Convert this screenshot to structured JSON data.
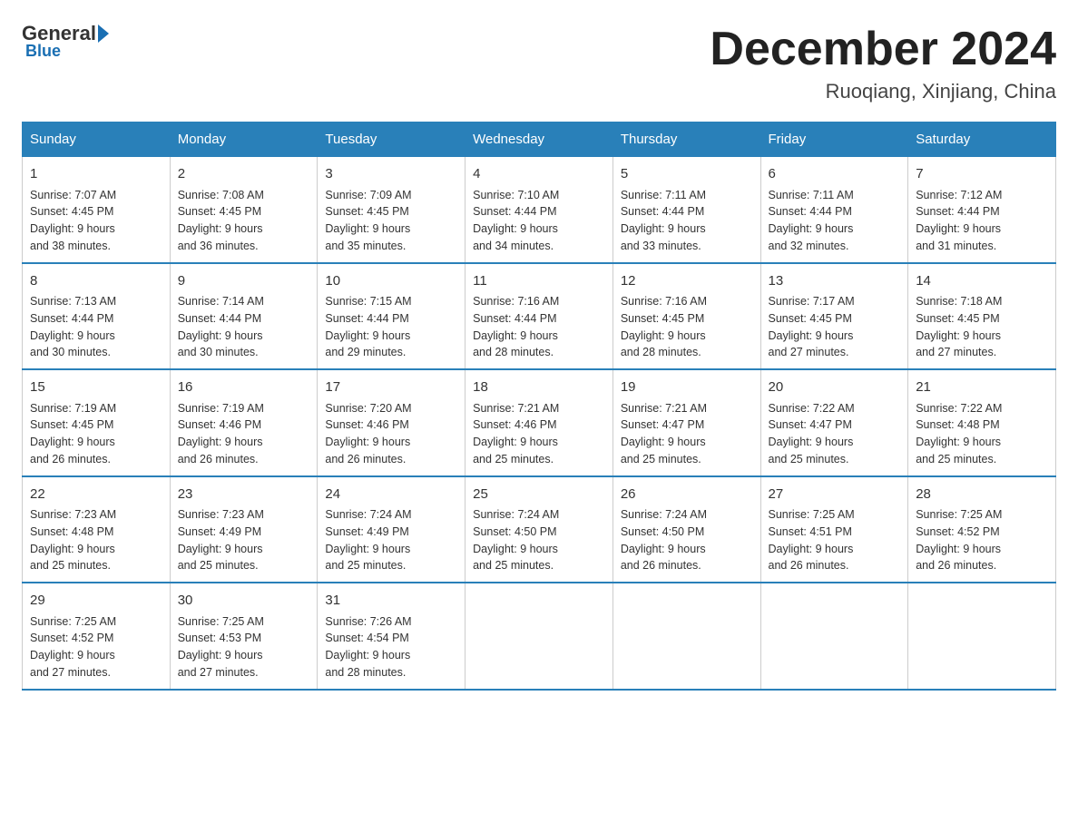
{
  "logo": {
    "general": "General",
    "blue": "Blue"
  },
  "title": "December 2024",
  "subtitle": "Ruoqiang, Xinjiang, China",
  "days_of_week": [
    "Sunday",
    "Monday",
    "Tuesday",
    "Wednesday",
    "Thursday",
    "Friday",
    "Saturday"
  ],
  "weeks": [
    [
      {
        "day": "1",
        "sunrise": "7:07 AM",
        "sunset": "4:45 PM",
        "daylight": "9 hours and 38 minutes."
      },
      {
        "day": "2",
        "sunrise": "7:08 AM",
        "sunset": "4:45 PM",
        "daylight": "9 hours and 36 minutes."
      },
      {
        "day": "3",
        "sunrise": "7:09 AM",
        "sunset": "4:45 PM",
        "daylight": "9 hours and 35 minutes."
      },
      {
        "day": "4",
        "sunrise": "7:10 AM",
        "sunset": "4:44 PM",
        "daylight": "9 hours and 34 minutes."
      },
      {
        "day": "5",
        "sunrise": "7:11 AM",
        "sunset": "4:44 PM",
        "daylight": "9 hours and 33 minutes."
      },
      {
        "day": "6",
        "sunrise": "7:11 AM",
        "sunset": "4:44 PM",
        "daylight": "9 hours and 32 minutes."
      },
      {
        "day": "7",
        "sunrise": "7:12 AM",
        "sunset": "4:44 PM",
        "daylight": "9 hours and 31 minutes."
      }
    ],
    [
      {
        "day": "8",
        "sunrise": "7:13 AM",
        "sunset": "4:44 PM",
        "daylight": "9 hours and 30 minutes."
      },
      {
        "day": "9",
        "sunrise": "7:14 AM",
        "sunset": "4:44 PM",
        "daylight": "9 hours and 30 minutes."
      },
      {
        "day": "10",
        "sunrise": "7:15 AM",
        "sunset": "4:44 PM",
        "daylight": "9 hours and 29 minutes."
      },
      {
        "day": "11",
        "sunrise": "7:16 AM",
        "sunset": "4:44 PM",
        "daylight": "9 hours and 28 minutes."
      },
      {
        "day": "12",
        "sunrise": "7:16 AM",
        "sunset": "4:45 PM",
        "daylight": "9 hours and 28 minutes."
      },
      {
        "day": "13",
        "sunrise": "7:17 AM",
        "sunset": "4:45 PM",
        "daylight": "9 hours and 27 minutes."
      },
      {
        "day": "14",
        "sunrise": "7:18 AM",
        "sunset": "4:45 PM",
        "daylight": "9 hours and 27 minutes."
      }
    ],
    [
      {
        "day": "15",
        "sunrise": "7:19 AM",
        "sunset": "4:45 PM",
        "daylight": "9 hours and 26 minutes."
      },
      {
        "day": "16",
        "sunrise": "7:19 AM",
        "sunset": "4:46 PM",
        "daylight": "9 hours and 26 minutes."
      },
      {
        "day": "17",
        "sunrise": "7:20 AM",
        "sunset": "4:46 PM",
        "daylight": "9 hours and 26 minutes."
      },
      {
        "day": "18",
        "sunrise": "7:21 AM",
        "sunset": "4:46 PM",
        "daylight": "9 hours and 25 minutes."
      },
      {
        "day": "19",
        "sunrise": "7:21 AM",
        "sunset": "4:47 PM",
        "daylight": "9 hours and 25 minutes."
      },
      {
        "day": "20",
        "sunrise": "7:22 AM",
        "sunset": "4:47 PM",
        "daylight": "9 hours and 25 minutes."
      },
      {
        "day": "21",
        "sunrise": "7:22 AM",
        "sunset": "4:48 PM",
        "daylight": "9 hours and 25 minutes."
      }
    ],
    [
      {
        "day": "22",
        "sunrise": "7:23 AM",
        "sunset": "4:48 PM",
        "daylight": "9 hours and 25 minutes."
      },
      {
        "day": "23",
        "sunrise": "7:23 AM",
        "sunset": "4:49 PM",
        "daylight": "9 hours and 25 minutes."
      },
      {
        "day": "24",
        "sunrise": "7:24 AM",
        "sunset": "4:49 PM",
        "daylight": "9 hours and 25 minutes."
      },
      {
        "day": "25",
        "sunrise": "7:24 AM",
        "sunset": "4:50 PM",
        "daylight": "9 hours and 25 minutes."
      },
      {
        "day": "26",
        "sunrise": "7:24 AM",
        "sunset": "4:50 PM",
        "daylight": "9 hours and 26 minutes."
      },
      {
        "day": "27",
        "sunrise": "7:25 AM",
        "sunset": "4:51 PM",
        "daylight": "9 hours and 26 minutes."
      },
      {
        "day": "28",
        "sunrise": "7:25 AM",
        "sunset": "4:52 PM",
        "daylight": "9 hours and 26 minutes."
      }
    ],
    [
      {
        "day": "29",
        "sunrise": "7:25 AM",
        "sunset": "4:52 PM",
        "daylight": "9 hours and 27 minutes."
      },
      {
        "day": "30",
        "sunrise": "7:25 AM",
        "sunset": "4:53 PM",
        "daylight": "9 hours and 27 minutes."
      },
      {
        "day": "31",
        "sunrise": "7:26 AM",
        "sunset": "4:54 PM",
        "daylight": "9 hours and 28 minutes."
      },
      null,
      null,
      null,
      null
    ]
  ]
}
